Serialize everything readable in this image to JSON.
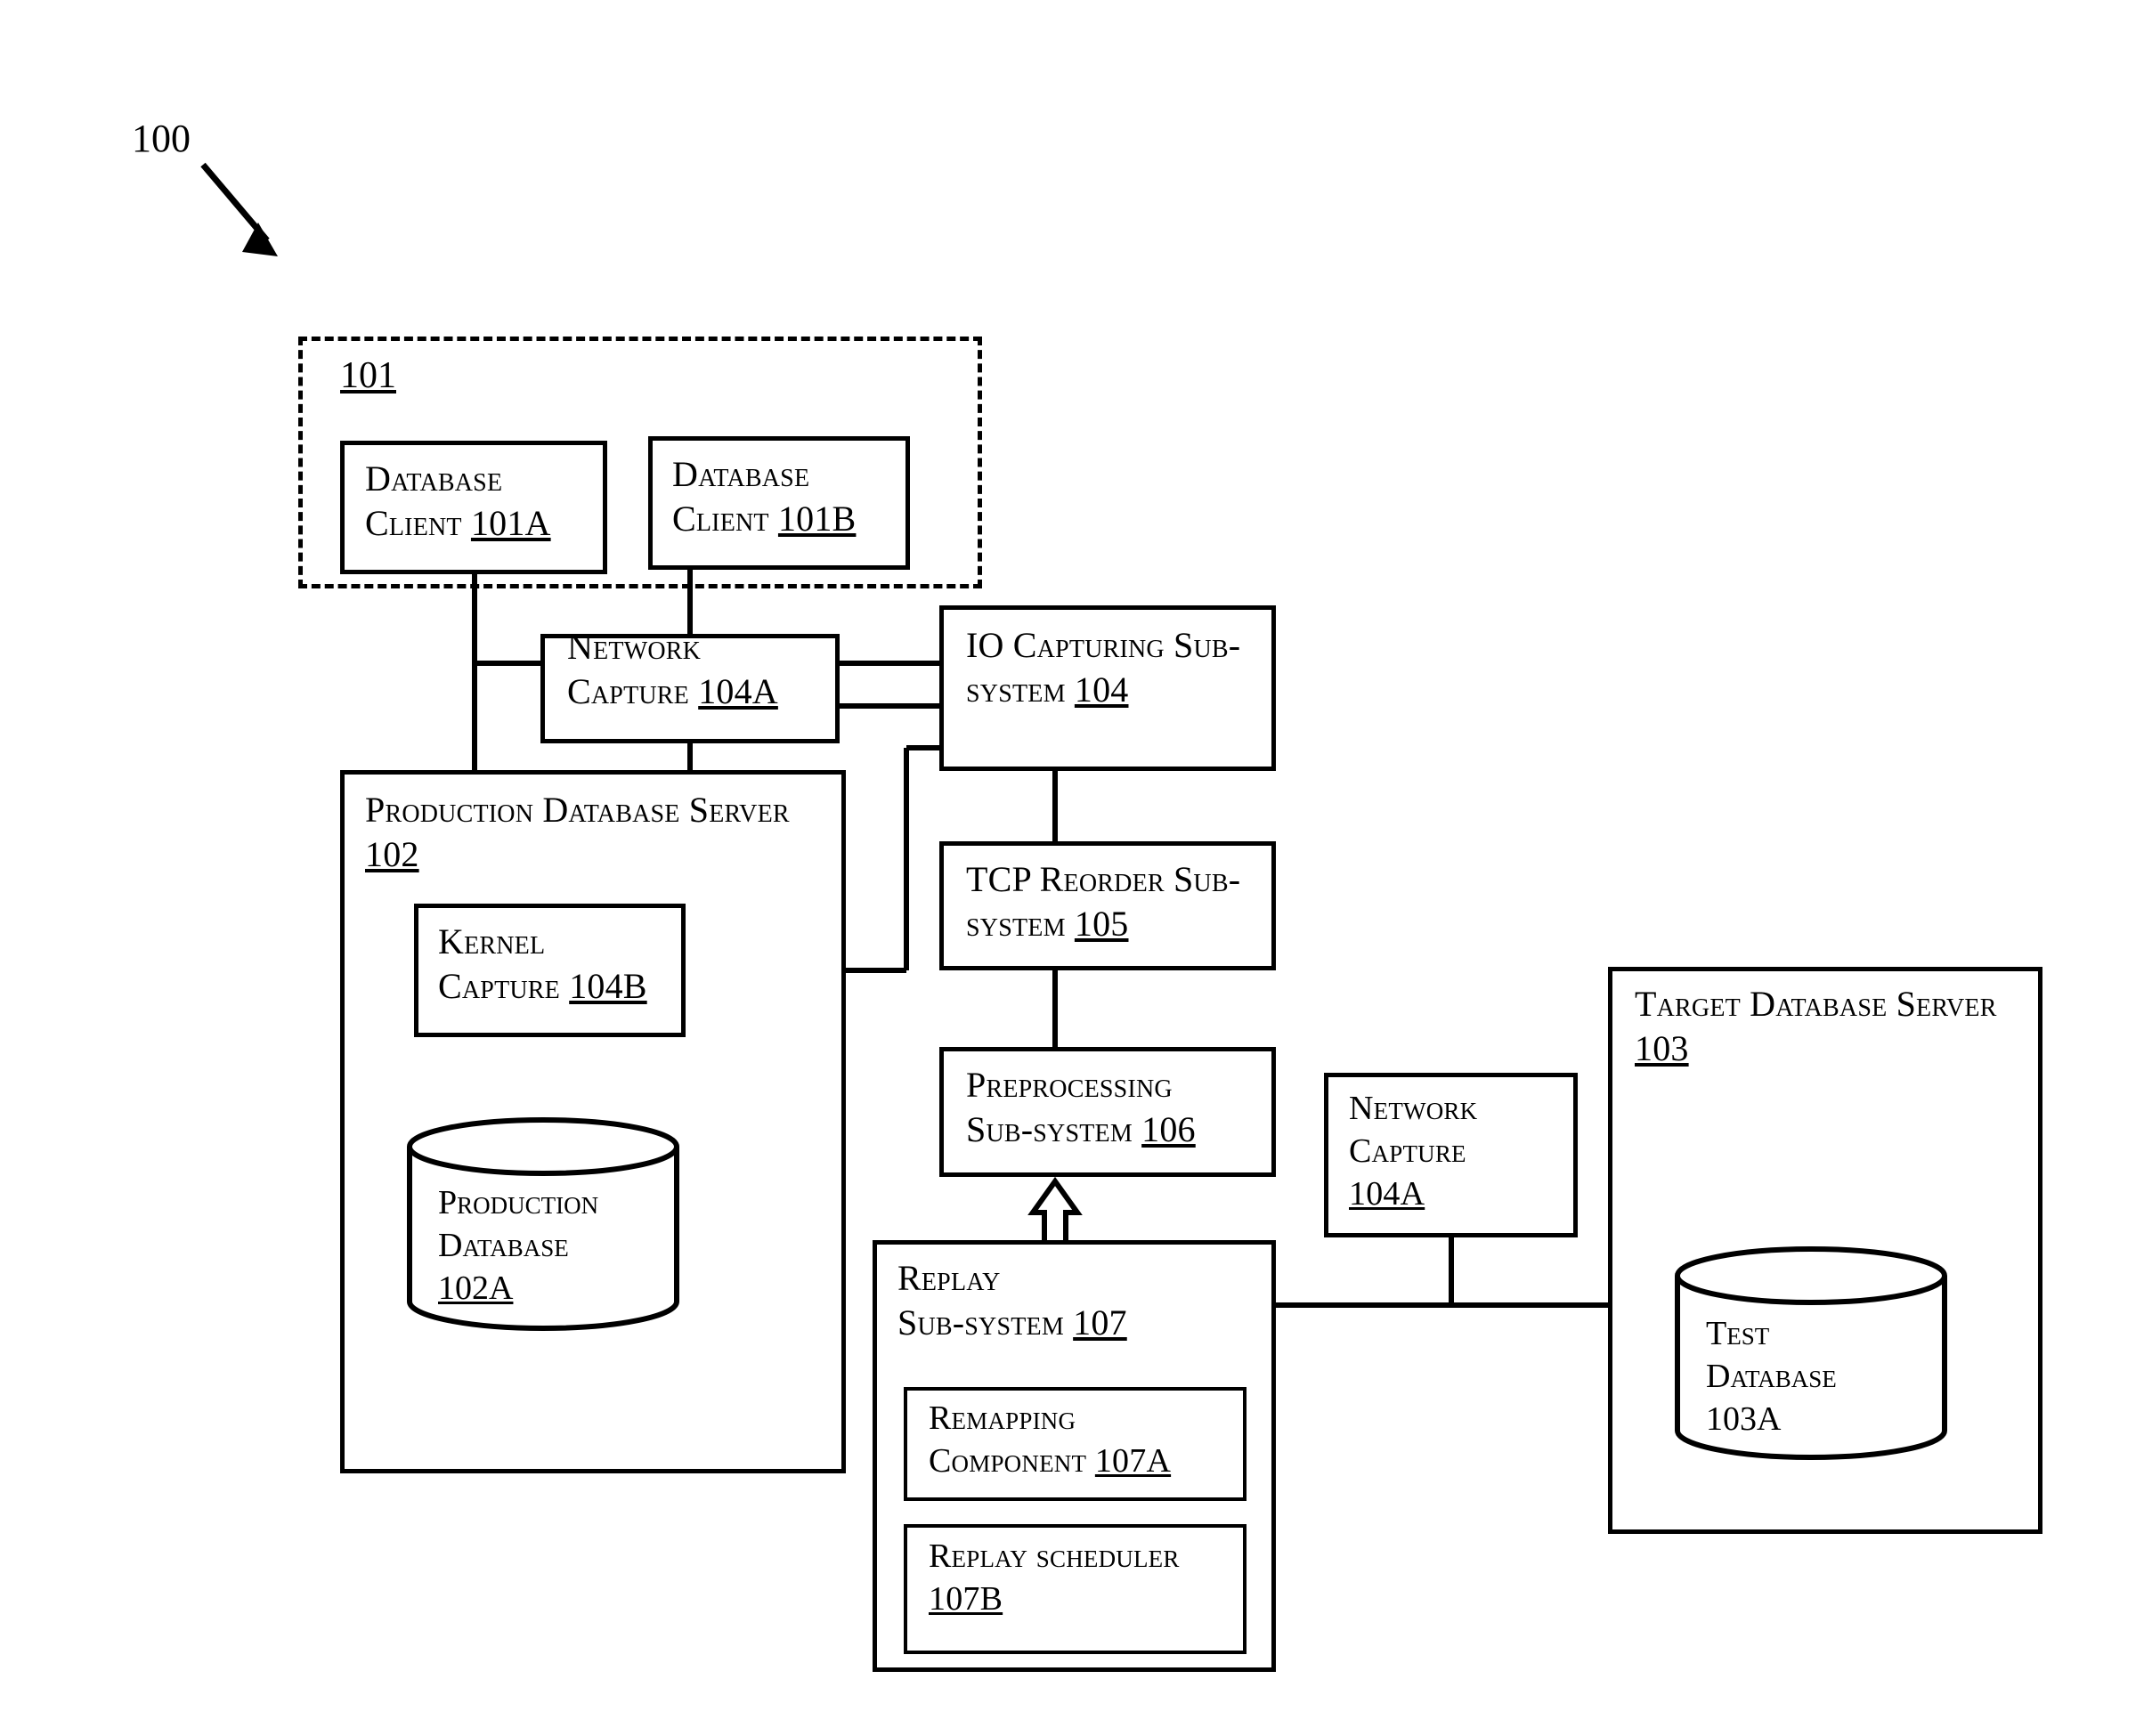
{
  "figure": {
    "number": "100",
    "group_label": "101"
  },
  "nodes": {
    "db_client_a": {
      "line1": "Database",
      "line2": "Client ",
      "ref": "101A"
    },
    "db_client_b": {
      "line1": "Database",
      "line2": "Client ",
      "ref": "101B"
    },
    "network_capture_left": {
      "line1": "Network",
      "line2": "Capture ",
      "ref": "104A"
    },
    "io_capturing": {
      "line1": "IO Capturing Sub-",
      "line2": "system ",
      "ref": "104"
    },
    "production_db_server": {
      "line1": "Production Database Server",
      "line2": "",
      "ref": "102"
    },
    "kernel_capture": {
      "line1": "Kernel",
      "line2": "Capture ",
      "ref": "104B"
    },
    "production_database": {
      "line1": "Production",
      "line2": "Database",
      "ref": "102A"
    },
    "tcp_reorder": {
      "line1": "TCP Reorder Sub-",
      "line2": "system ",
      "ref": "105"
    },
    "preprocessing": {
      "line1": "Preprocessing",
      "line2": "Sub-system ",
      "ref": "106"
    },
    "replay_subsystem": {
      "line1": "Replay",
      "line2": "Sub-system ",
      "ref": "107"
    },
    "remapping_component": {
      "line1": "Remapping",
      "line2": "Component ",
      "ref": "107A"
    },
    "replay_scheduler": {
      "line1": "Replay scheduler",
      "line2": "",
      "ref": "107B"
    },
    "network_capture_right": {
      "line1": "Network",
      "line2": "Capture",
      "ref": "104A"
    },
    "target_db_server": {
      "line1": "Target Database Server",
      "line2": "",
      "ref": "103"
    },
    "test_database": {
      "line1": "Test",
      "line2": "Database",
      "ref": "103A"
    }
  },
  "colors": {
    "stroke": "#000000",
    "background": "#ffffff"
  }
}
